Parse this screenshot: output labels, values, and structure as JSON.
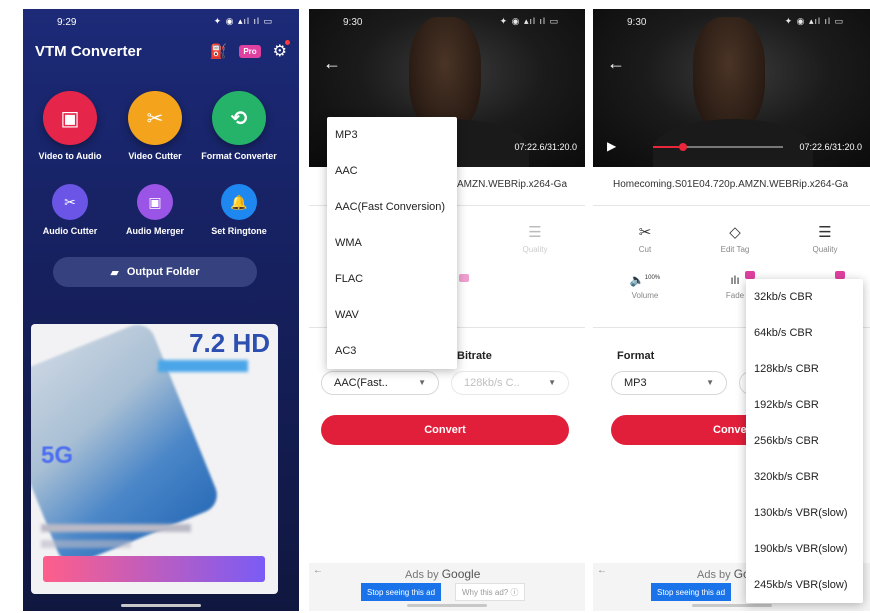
{
  "phone1": {
    "time": "9:29",
    "status_icons": "✦ ◉ ▴ıl ıl ▭",
    "app_title": "VTM Converter",
    "pro_label": "Pro",
    "tools_primary": [
      {
        "label": "Video to Audio",
        "color": "#e5264a",
        "icon": "▣"
      },
      {
        "label": "Video Cutter",
        "color": "#f4a41c",
        "icon": "✂"
      },
      {
        "label": "Format Converter",
        "color": "#25b36a",
        "icon": "⟲"
      }
    ],
    "tools_secondary": [
      {
        "label": "Audio Cutter",
        "color": "#6a55e6",
        "icon": "✂"
      },
      {
        "label": "Audio Merger",
        "color": "#9a55e6",
        "icon": "▣"
      },
      {
        "label": "Set Ringtone",
        "color": "#1e88f0",
        "icon": "🔔"
      }
    ],
    "output_folder_label": "Output Folder",
    "ad": {
      "hd_text": "7.2 HD",
      "five_g": "5G"
    }
  },
  "phone2": {
    "time": "9:30",
    "status_icons": "✦ ◉ ▴ıl ıl ▭",
    "timecode": "07:22.6/31:20.0",
    "filename_fragment": "AMZN.WEBRip.x264-Ga",
    "quality_label": "Quality",
    "bitrate_label": "Bitrate",
    "format_value": "AAC(Fast..",
    "bitrate_value": "128kb/s C..",
    "convert_label": "Convert",
    "format_options": [
      "MP3",
      "AAC",
      "AAC(Fast Conversion)",
      "WMA",
      "FLAC",
      "WAV",
      "AC3"
    ],
    "ads": {
      "ads_by": "Ads by",
      "google": "Google",
      "stop": "Stop seeing this ad",
      "why": "Why this ad? ⓘ"
    }
  },
  "phone3": {
    "time": "9:30",
    "status_icons": "✦ ◉ ▴ıl ıl ▭",
    "timecode": "07:22.6/31:20.0",
    "progress": 0.23,
    "filename": "Homecoming.S01E04.720p.AMZN.WEBRip.x264-Ga",
    "tools": [
      {
        "label": "Cut",
        "icon": "✂"
      },
      {
        "label": "Edit Tag",
        "icon": "◇"
      },
      {
        "label": "Quality",
        "icon": "☰"
      }
    ],
    "volume_label": "Volume",
    "volume_badge": "100%",
    "fade_label": "Fade",
    "format_label": "Format",
    "format_value": "MP3",
    "convert_label": "Conve",
    "bitrate_options": [
      "32kb/s CBR",
      "64kb/s CBR",
      "128kb/s CBR",
      "192kb/s CBR",
      "256kb/s CBR",
      "320kb/s CBR",
      "130kb/s VBR(slow)",
      "190kb/s VBR(slow)",
      "245kb/s VBR(slow)"
    ],
    "ads": {
      "ads_by": "Ads by",
      "google": "Gc",
      "stop": "Stop seeing this ad"
    }
  }
}
